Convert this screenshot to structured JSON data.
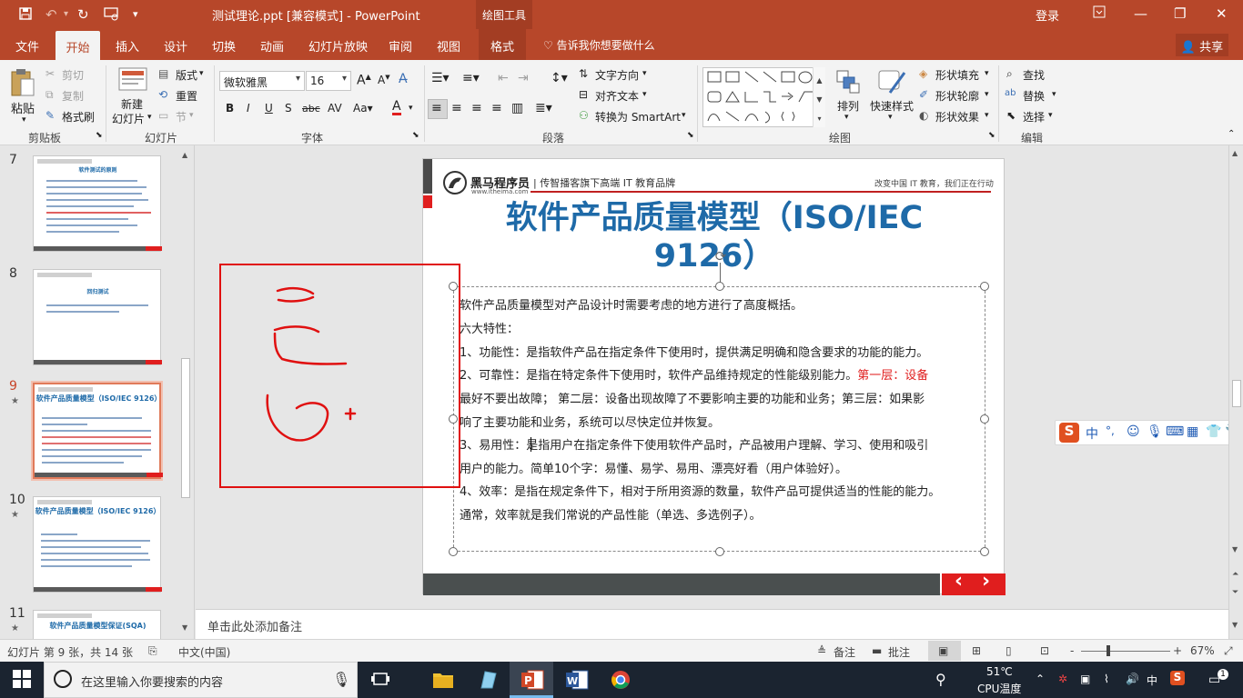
{
  "window": {
    "title": "测试理论.ppt [兼容模式]  -  PowerPoint",
    "context_tab": "绘图工具",
    "login": "登录",
    "accent": "#b7472a"
  },
  "tabs": [
    "文件",
    "开始",
    "插入",
    "设计",
    "切换",
    "动画",
    "幻灯片放映",
    "审阅",
    "视图",
    "格式"
  ],
  "tellme": "告诉我你想要做什么",
  "share": "共享",
  "ribbon": {
    "clipboard": {
      "label": "剪贴板",
      "paste": "粘贴",
      "cut": "剪切",
      "copy": "复制",
      "painter": "格式刷"
    },
    "slides": {
      "label": "幻灯片",
      "new_slide_1": "新建",
      "new_slide_2": "幻灯片",
      "layout": "版式",
      "reset": "重置",
      "section": "节"
    },
    "font": {
      "label": "字体",
      "name": "微软雅黑",
      "size": "16"
    },
    "paragraph": {
      "label": "段落",
      "text_direction": "文字方向",
      "align_text": "对齐文本",
      "smartart": "转换为 SmartArt"
    },
    "drawing": {
      "label": "绘图",
      "arrange": "排列",
      "quick_styles": "快速样式",
      "shape_fill": "形状填充",
      "shape_outline": "形状轮廓",
      "shape_effects": "形状效果"
    },
    "editing": {
      "label": "编辑",
      "find": "查找",
      "replace": "替换",
      "select": "选择"
    }
  },
  "thumbnails": [
    {
      "num": "7",
      "title": "软件测试的原则"
    },
    {
      "num": "8",
      "title": "回归测试"
    },
    {
      "num": "9",
      "title": "软件产品质量模型（ISO/IEC 9126）",
      "star": "★"
    },
    {
      "num": "10",
      "title": "软件产品质量模型（ISO/IEC 9126）",
      "star": "★"
    },
    {
      "num": "11",
      "title": "软件产品质量模型保证(SQA)",
      "star": "★"
    }
  ],
  "slide": {
    "brand": "黑马程序员",
    "brand_url": "www.itheima.com",
    "tagline": "| 传智播客旗下高端 IT 教育品牌",
    "slogan": "改变中国 IT 教育，我们正在行动",
    "title_line1": "软件产品质量模型（ISO/IEC",
    "title_line2": "9126）",
    "body": {
      "p1": "软件产品质量模型对产品设计时需要考虑的地方进行了高度概括。",
      "p2": "六大特性：",
      "p3": "1、功能性：是指软件产品在指定条件下使用时，提供满足明确和隐含要求的功能的能力。",
      "p4a": "2、可靠性：是指在特定条件下使用时，软件产品维持规定的性能级别能力。",
      "p4b": "第一层：设备",
      "p5": "最好不要出故障；  第二层：设备出现故障了不要影响主要的功能和业务；第三层：如果影",
      "p6": "响了主要功能和业务，系统可以尽快定位并恢复。",
      "p7": "3、易用性：是指用户在指定条件下使用软件产品时，产品被用户理解、学习、使用和吸引",
      "p8": "用户的能力。简单10个字：易懂、易学、易用、漂亮好看（用户体验好）。",
      "p9": "4、效率：是指在规定条件下，相对于所用资源的数量，软件产品可提供适当的性能的能力。",
      "p10": "通常，效率就是我们常说的产品性能（单选、多选例子）。"
    },
    "nav_prev": "‹",
    "nav_next": "›"
  },
  "notes_placeholder": "单击此处添加备注",
  "status": {
    "slide_count": "幻灯片 第 9 张，共 14 张",
    "language": "中文(中国)",
    "notes": "备注",
    "comments": "批注",
    "zoom": "67%",
    "zoom_minus": "-",
    "zoom_plus": "+"
  },
  "ime": {
    "zh": "中",
    "punct": "°,"
  },
  "taskbar": {
    "search_placeholder": "在这里输入你要搜索的内容",
    "temp": "51℃",
    "temp_label": "CPU温度",
    "ime": "中",
    "notif": "1"
  }
}
